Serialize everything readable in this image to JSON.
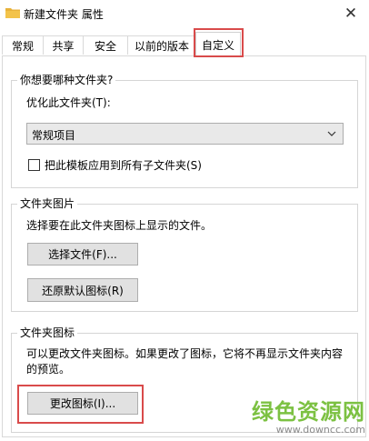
{
  "window": {
    "title": "新建文件夹 属性",
    "close_glyph": "✕"
  },
  "tabs": [
    {
      "label": "常规"
    },
    {
      "label": "共享"
    },
    {
      "label": "安全"
    },
    {
      "label": "以前的版本"
    },
    {
      "label": "自定义",
      "active": true
    }
  ],
  "section_type": {
    "title": "你想要哪种文件夹?",
    "optimize_label": "优化此文件夹(T):",
    "optimize_value": "常规项目",
    "apply_template_label": "把此模板应用到所有子文件夹(S)",
    "apply_template_checked": false
  },
  "section_picture": {
    "title": "文件夹图片",
    "description": "选择要在此文件夹图标上显示的文件。",
    "choose_file_button": "选择文件(F)...",
    "restore_default_button": "还原默认图标(R)"
  },
  "section_icon": {
    "title": "文件夹图标",
    "description_line1": "可以更改文件夹图标。如果更改了图标，它将不再显示文件夹内容",
    "description_line2": "的预览。",
    "change_icon_button": "更改图标(I)..."
  },
  "watermark": {
    "brand": "绿色资源网",
    "url": "www.downcc.com"
  },
  "colors": {
    "highlight": "#d94b4b",
    "watermark_green": "#7cc142",
    "folder_yellow": "#f3c34a"
  }
}
